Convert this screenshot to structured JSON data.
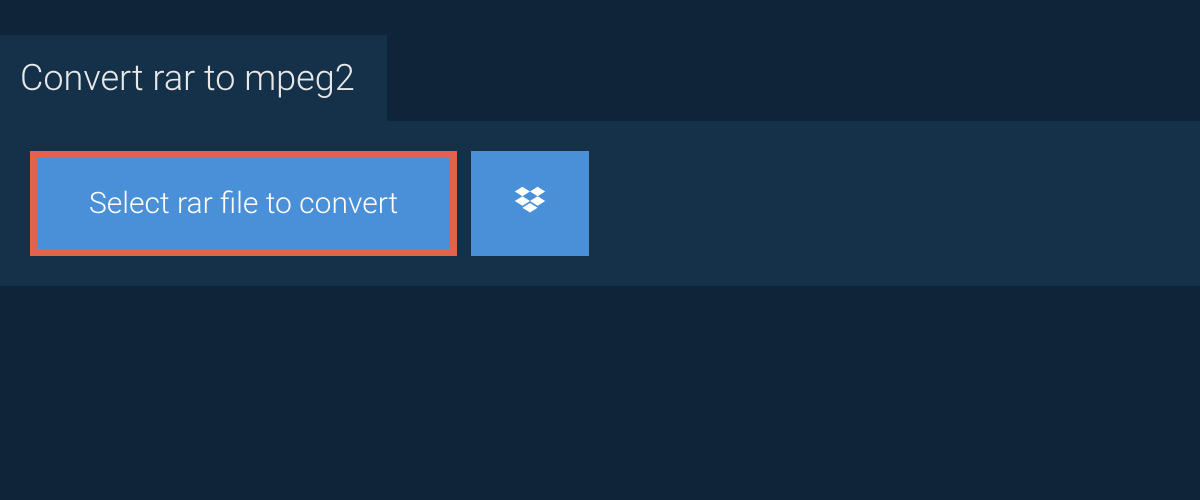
{
  "header": {
    "title": "Convert rar to mpeg2"
  },
  "main": {
    "select_button_label": "Select rar file to convert"
  },
  "colors": {
    "background": "#0f2438",
    "panel": "#153149",
    "button_primary": "#4a90d9",
    "highlight_border": "#e2624e",
    "text_light": "#e8e8e8",
    "text_white": "#ffffff"
  }
}
